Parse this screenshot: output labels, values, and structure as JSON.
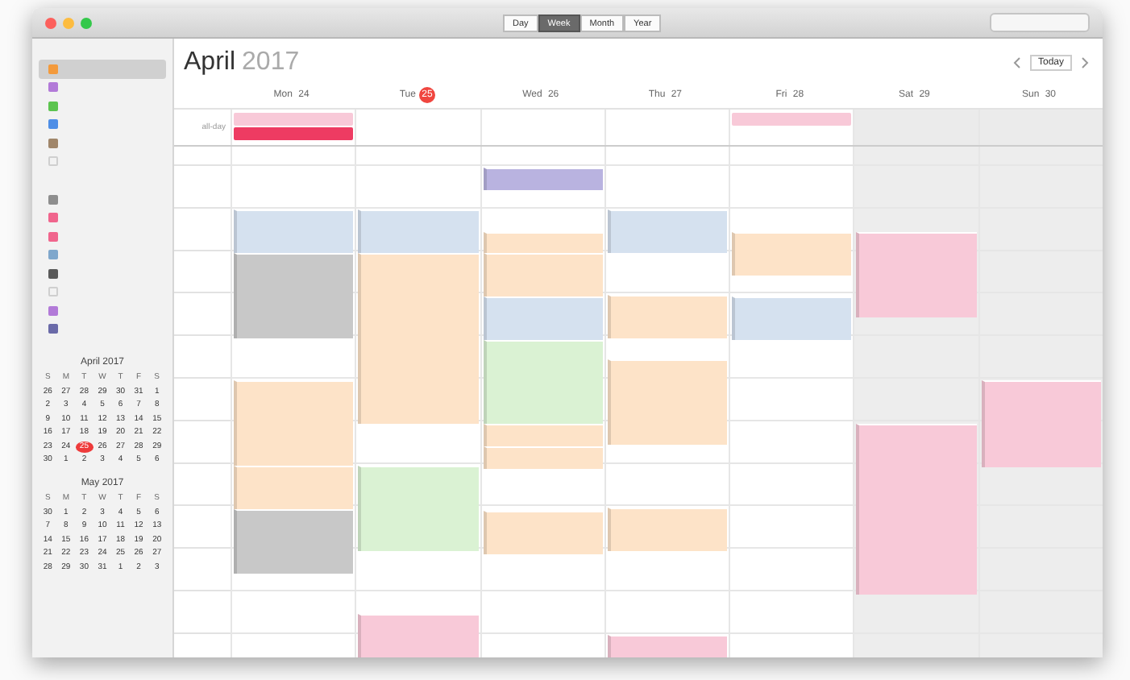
{
  "toolbar": {
    "views": [
      {
        "label": "Day",
        "selected": false
      },
      {
        "label": "Week",
        "selected": true
      },
      {
        "label": "Month",
        "selected": false
      },
      {
        "label": "Year",
        "selected": false
      }
    ]
  },
  "sidebar": {
    "groups": [
      {
        "items": [
          {
            "color": "#f39a3c",
            "checked": true,
            "selected": true
          },
          {
            "color": "#b27ad8",
            "checked": true,
            "selected": false
          },
          {
            "color": "#5cc44f",
            "checked": true,
            "selected": false
          },
          {
            "color": "#4e8ee6",
            "checked": true,
            "selected": false
          },
          {
            "color": "#a0866a",
            "checked": true,
            "selected": false
          },
          {
            "color": "#cfcfcf",
            "checked": false,
            "selected": false
          }
        ]
      },
      {
        "items": [
          {
            "color": "#8e8e8e",
            "checked": true,
            "selected": false
          },
          {
            "color": "#f0658d",
            "checked": true,
            "selected": false
          },
          {
            "color": "#f0658d",
            "checked": true,
            "selected": false
          },
          {
            "color": "#7fa7cc",
            "checked": true,
            "selected": false
          },
          {
            "color": "#5a5a5a",
            "checked": true,
            "selected": false
          },
          {
            "color": "#cfcfcf",
            "checked": false,
            "selected": false
          },
          {
            "color": "#b27ad8",
            "checked": true,
            "selected": false
          },
          {
            "color": "#6a6aa8",
            "checked": true,
            "selected": false
          }
        ]
      }
    ],
    "mini_calendars": [
      {
        "title": "April 2017",
        "weekdays": [
          "S",
          "M",
          "T",
          "W",
          "T",
          "F",
          "S"
        ],
        "days": [
          {
            "label": "26",
            "selected": false
          },
          {
            "label": "27",
            "selected": false
          },
          {
            "label": "28",
            "selected": false
          },
          {
            "label": "29",
            "selected": false
          },
          {
            "label": "30",
            "selected": false
          },
          {
            "label": "31",
            "selected": false
          },
          {
            "label": "1",
            "selected": false
          },
          {
            "label": "2",
            "selected": false
          },
          {
            "label": "3",
            "selected": false
          },
          {
            "label": "4",
            "selected": false
          },
          {
            "label": "5",
            "selected": false
          },
          {
            "label": "6",
            "selected": false
          },
          {
            "label": "7",
            "selected": false
          },
          {
            "label": "8",
            "selected": false
          },
          {
            "label": "9",
            "selected": false
          },
          {
            "label": "10",
            "selected": false
          },
          {
            "label": "11",
            "selected": false
          },
          {
            "label": "12",
            "selected": false
          },
          {
            "label": "13",
            "selected": false
          },
          {
            "label": "14",
            "selected": false
          },
          {
            "label": "15",
            "selected": false
          },
          {
            "label": "16",
            "selected": false
          },
          {
            "label": "17",
            "selected": false
          },
          {
            "label": "18",
            "selected": false
          },
          {
            "label": "19",
            "selected": false
          },
          {
            "label": "20",
            "selected": false
          },
          {
            "label": "21",
            "selected": false
          },
          {
            "label": "22",
            "selected": false
          },
          {
            "label": "23",
            "selected": false
          },
          {
            "label": "24",
            "selected": false
          },
          {
            "label": "25",
            "selected": true
          },
          {
            "label": "26",
            "selected": false
          },
          {
            "label": "27",
            "selected": false
          },
          {
            "label": "28",
            "selected": false
          },
          {
            "label": "29",
            "selected": false
          },
          {
            "label": "30",
            "selected": false
          },
          {
            "label": "1",
            "selected": false
          },
          {
            "label": "2",
            "selected": false
          },
          {
            "label": "3",
            "selected": false
          },
          {
            "label": "4",
            "selected": false
          },
          {
            "label": "5",
            "selected": false
          },
          {
            "label": "6",
            "selected": false
          }
        ]
      },
      {
        "title": "May 2017",
        "weekdays": [
          "S",
          "M",
          "T",
          "W",
          "T",
          "F",
          "S"
        ],
        "days": [
          {
            "label": "30",
            "selected": false
          },
          {
            "label": "1",
            "selected": false
          },
          {
            "label": "2",
            "selected": false
          },
          {
            "label": "3",
            "selected": false
          },
          {
            "label": "4",
            "selected": false
          },
          {
            "label": "5",
            "selected": false
          },
          {
            "label": "6",
            "selected": false
          },
          {
            "label": "7",
            "selected": false
          },
          {
            "label": "8",
            "selected": false
          },
          {
            "label": "9",
            "selected": false
          },
          {
            "label": "10",
            "selected": false
          },
          {
            "label": "11",
            "selected": false
          },
          {
            "label": "12",
            "selected": false
          },
          {
            "label": "13",
            "selected": false
          },
          {
            "label": "14",
            "selected": false
          },
          {
            "label": "15",
            "selected": false
          },
          {
            "label": "16",
            "selected": false
          },
          {
            "label": "17",
            "selected": false
          },
          {
            "label": "18",
            "selected": false
          },
          {
            "label": "19",
            "selected": false
          },
          {
            "label": "20",
            "selected": false
          },
          {
            "label": "21",
            "selected": false
          },
          {
            "label": "22",
            "selected": false
          },
          {
            "label": "23",
            "selected": false
          },
          {
            "label": "24",
            "selected": false
          },
          {
            "label": "25",
            "selected": false
          },
          {
            "label": "26",
            "selected": false
          },
          {
            "label": "27",
            "selected": false
          },
          {
            "label": "28",
            "selected": false
          },
          {
            "label": "29",
            "selected": false
          },
          {
            "label": "30",
            "selected": false
          },
          {
            "label": "31",
            "selected": false
          },
          {
            "label": "1",
            "selected": false
          },
          {
            "label": "2",
            "selected": false
          },
          {
            "label": "3",
            "selected": false
          }
        ]
      }
    ]
  },
  "header": {
    "month": "April",
    "year": "2017",
    "today_button": "Today"
  },
  "all_day_label": "all-day",
  "days": [
    {
      "name": "Mon",
      "date": "24",
      "selected": false,
      "weekend": false,
      "all_day": [
        {
          "color": "#f8c9d8"
        },
        {
          "color": "#ee3b62"
        }
      ],
      "slots": [
        {
          "kind": "free"
        },
        {
          "kind": "free"
        },
        {
          "kind": "free"
        },
        {
          "kind": "start",
          "color": "#d5e1ef"
        },
        {
          "kind": "more"
        },
        {
          "kind": "start",
          "color": "#c8c8c8"
        },
        {
          "kind": "more"
        },
        {
          "kind": "more"
        },
        {
          "kind": "more"
        },
        {
          "kind": "free"
        },
        {
          "kind": "free"
        },
        {
          "kind": "start",
          "color": "#fde3c8"
        },
        {
          "kind": "more"
        },
        {
          "kind": "more"
        },
        {
          "kind": "more"
        },
        {
          "kind": "start",
          "color": "#fde3c8"
        },
        {
          "kind": "more"
        },
        {
          "kind": "start",
          "color": "#c8c8c8"
        },
        {
          "kind": "more"
        },
        {
          "kind": "more"
        },
        {
          "kind": "free"
        },
        {
          "kind": "free"
        },
        {
          "kind": "free"
        },
        {
          "kind": "free"
        }
      ]
    },
    {
      "name": "Tue",
      "date": "25",
      "selected": true,
      "weekend": false,
      "slots": [
        {
          "kind": "free"
        },
        {
          "kind": "free"
        },
        {
          "kind": "free"
        },
        {
          "kind": "start",
          "color": "#d5e1ef"
        },
        {
          "kind": "more"
        },
        {
          "kind": "start",
          "color": "#fde3c8"
        },
        {
          "kind": "more"
        },
        {
          "kind": "more"
        },
        {
          "kind": "more"
        },
        {
          "kind": "more"
        },
        {
          "kind": "more"
        },
        {
          "kind": "more"
        },
        {
          "kind": "more"
        },
        {
          "kind": "free"
        },
        {
          "kind": "free"
        },
        {
          "kind": "start",
          "color": "#daf2d3"
        },
        {
          "kind": "more"
        },
        {
          "kind": "more"
        },
        {
          "kind": "more"
        },
        {
          "kind": "free"
        },
        {
          "kind": "free"
        },
        {
          "kind": "free"
        },
        {
          "kind": "start",
          "color": "#f8c9d8"
        },
        {
          "kind": "more"
        }
      ]
    },
    {
      "name": "Wed",
      "date": "26",
      "selected": false,
      "weekend": false,
      "slots": [
        {
          "kind": "free"
        },
        {
          "kind": "start",
          "color": "#b9b3e0"
        },
        {
          "kind": "free"
        },
        {
          "kind": "free"
        },
        {
          "kind": "start",
          "color": "#fde3c8"
        },
        {
          "kind": "start",
          "color": "#fde3c8"
        },
        {
          "kind": "more"
        },
        {
          "kind": "start",
          "color": "#d5e1ef"
        },
        {
          "kind": "more"
        },
        {
          "kind": "start",
          "color": "#daf2d3"
        },
        {
          "kind": "more"
        },
        {
          "kind": "more"
        },
        {
          "kind": "more"
        },
        {
          "kind": "start",
          "color": "#fde3c8"
        },
        {
          "kind": "start",
          "color": "#fde3c8"
        },
        {
          "kind": "free"
        },
        {
          "kind": "free"
        },
        {
          "kind": "start",
          "color": "#fde3c8"
        },
        {
          "kind": "more"
        },
        {
          "kind": "free"
        },
        {
          "kind": "free"
        },
        {
          "kind": "free"
        },
        {
          "kind": "free"
        },
        {
          "kind": "free"
        }
      ]
    },
    {
      "name": "Thu",
      "date": "27",
      "selected": false,
      "weekend": false,
      "slots": [
        {
          "kind": "free"
        },
        {
          "kind": "free"
        },
        {
          "kind": "free"
        },
        {
          "kind": "start",
          "color": "#d5e1ef"
        },
        {
          "kind": "more"
        },
        {
          "kind": "free"
        },
        {
          "kind": "free"
        },
        {
          "kind": "start",
          "color": "#fde3c8"
        },
        {
          "kind": "more"
        },
        {
          "kind": "free"
        },
        {
          "kind": "start",
          "color": "#fde3c8"
        },
        {
          "kind": "more"
        },
        {
          "kind": "more"
        },
        {
          "kind": "more"
        },
        {
          "kind": "free"
        },
        {
          "kind": "free"
        },
        {
          "kind": "free"
        },
        {
          "kind": "start",
          "color": "#fde3c8"
        },
        {
          "kind": "more"
        },
        {
          "kind": "free"
        },
        {
          "kind": "free"
        },
        {
          "kind": "free"
        },
        {
          "kind": "free"
        },
        {
          "kind": "start",
          "color": "#f8c9d8"
        }
      ]
    },
    {
      "name": "Fri",
      "date": "28",
      "selected": false,
      "weekend": false,
      "all_day": [
        {
          "color": "#f8c9d8"
        }
      ],
      "slots": [
        {
          "kind": "free"
        },
        {
          "kind": "free"
        },
        {
          "kind": "free"
        },
        {
          "kind": "free"
        },
        {
          "kind": "start",
          "color": "#fde3c8"
        },
        {
          "kind": "more"
        },
        {
          "kind": "free"
        },
        {
          "kind": "start",
          "color": "#d5e1ef"
        },
        {
          "kind": "more"
        },
        {
          "kind": "free"
        },
        {
          "kind": "free"
        },
        {
          "kind": "free"
        },
        {
          "kind": "free"
        },
        {
          "kind": "free"
        },
        {
          "kind": "free"
        },
        {
          "kind": "free"
        },
        {
          "kind": "free"
        },
        {
          "kind": "free"
        },
        {
          "kind": "free"
        },
        {
          "kind": "free"
        },
        {
          "kind": "free"
        },
        {
          "kind": "free"
        },
        {
          "kind": "free"
        },
        {
          "kind": "free"
        }
      ]
    },
    {
      "name": "Sat",
      "date": "29",
      "selected": false,
      "weekend": true,
      "slots": [
        {
          "kind": "free"
        },
        {
          "kind": "free"
        },
        {
          "kind": "free"
        },
        {
          "kind": "free"
        },
        {
          "kind": "start",
          "color": "#f8c9d8"
        },
        {
          "kind": "more"
        },
        {
          "kind": "more"
        },
        {
          "kind": "more"
        },
        {
          "kind": "free"
        },
        {
          "kind": "free"
        },
        {
          "kind": "free"
        },
        {
          "kind": "free"
        },
        {
          "kind": "free"
        },
        {
          "kind": "start",
          "color": "#f8c9d8"
        },
        {
          "kind": "more"
        },
        {
          "kind": "more"
        },
        {
          "kind": "more"
        },
        {
          "kind": "more"
        },
        {
          "kind": "more"
        },
        {
          "kind": "more"
        },
        {
          "kind": "more"
        },
        {
          "kind": "free"
        },
        {
          "kind": "free"
        },
        {
          "kind": "free"
        }
      ]
    },
    {
      "name": "Sun",
      "date": "30",
      "selected": false,
      "weekend": true,
      "slots": [
        {
          "kind": "free"
        },
        {
          "kind": "free"
        },
        {
          "kind": "free"
        },
        {
          "kind": "free"
        },
        {
          "kind": "free"
        },
        {
          "kind": "free"
        },
        {
          "kind": "free"
        },
        {
          "kind": "free"
        },
        {
          "kind": "free"
        },
        {
          "kind": "free"
        },
        {
          "kind": "free"
        },
        {
          "kind": "start",
          "color": "#f8c9d8"
        },
        {
          "kind": "more"
        },
        {
          "kind": "more"
        },
        {
          "kind": "more"
        },
        {
          "kind": "free"
        },
        {
          "kind": "free"
        },
        {
          "kind": "free"
        },
        {
          "kind": "free"
        },
        {
          "kind": "free"
        },
        {
          "kind": "free"
        },
        {
          "kind": "free"
        },
        {
          "kind": "free"
        },
        {
          "kind": "free"
        }
      ]
    }
  ]
}
